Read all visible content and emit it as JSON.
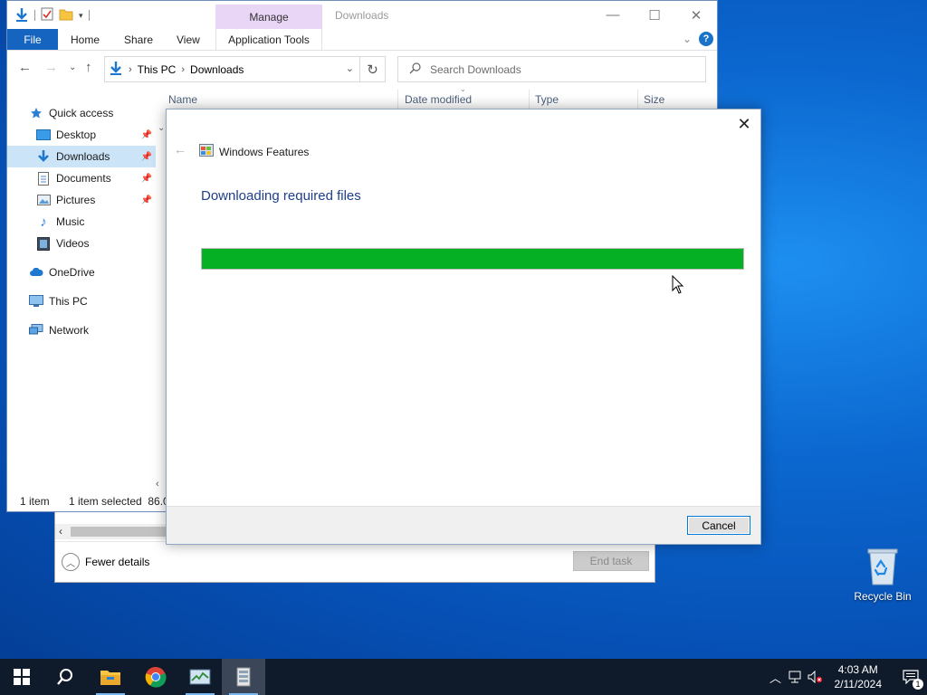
{
  "desktop": {
    "recycle_bin_label": "Recycle Bin"
  },
  "explorer": {
    "title": "Downloads",
    "manage_tab": "Manage",
    "ribbon": {
      "file": "File",
      "home": "Home",
      "share": "Share",
      "view": "View",
      "application_tools": "Application Tools"
    },
    "address": {
      "crumb_1": "This PC",
      "crumb_2": "Downloads"
    },
    "search": {
      "placeholder": "Search Downloads"
    },
    "nav": {
      "quick_access": "Quick access",
      "desktop": "Desktop",
      "downloads": "Downloads",
      "documents": "Documents",
      "pictures": "Pictures",
      "music": "Music",
      "videos": "Videos",
      "onedrive": "OneDrive",
      "this_pc": "This PC",
      "network": "Network"
    },
    "columns": {
      "name": "Name",
      "date_modified": "Date modified",
      "type": "Type",
      "size": "Size"
    },
    "status": {
      "item_count": "1 item",
      "selected": "1 item selected  86.0"
    }
  },
  "task_manager": {
    "fewer_details": "Fewer details",
    "end_task": "End task"
  },
  "dialog": {
    "title": "Windows Features",
    "heading": "Downloading required files",
    "progress_fraction": 1.0,
    "cancel_label": "Cancel"
  },
  "taskbar": {
    "time": "4:03 AM",
    "date": "2/11/2024",
    "notification_count": "1"
  },
  "colors": {
    "accent": "#1565c0",
    "progress_green": "#06b025",
    "manage_tab": "#e9d6f7",
    "dialog_heading": "#1f3f8a"
  }
}
